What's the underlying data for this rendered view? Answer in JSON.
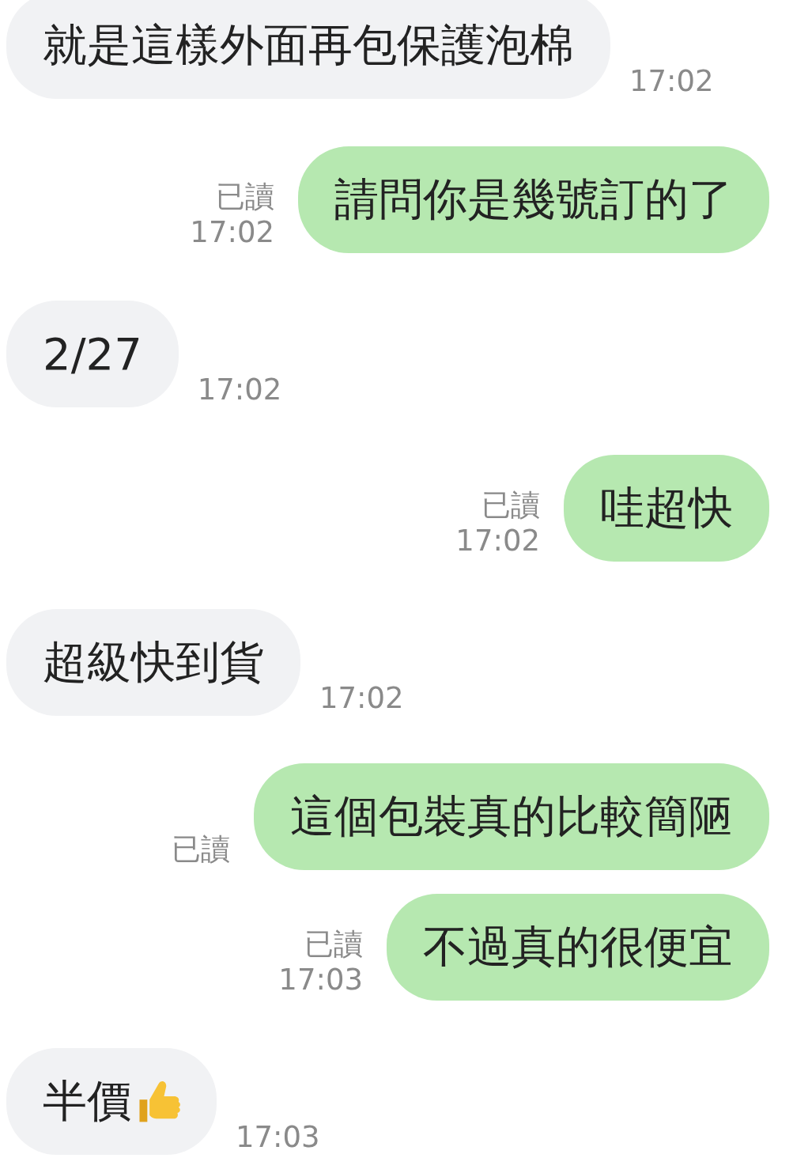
{
  "messages": [
    {
      "kind": "incoming",
      "text": "就是這樣外面再包保護泡棉",
      "time": "17:02"
    },
    {
      "kind": "outgoing",
      "text": "請問你是幾號訂的了",
      "read_label": "已讀",
      "time": "17:02"
    },
    {
      "kind": "incoming",
      "text": "2/27",
      "time": "17:02"
    },
    {
      "kind": "outgoing",
      "text": "哇超快",
      "read_label": "已讀",
      "time": "17:02"
    },
    {
      "kind": "incoming",
      "text": "超級快到貨",
      "time": "17:02"
    },
    {
      "kind": "outgoing",
      "text": "這個包裝真的比較簡陋",
      "read_label": "已讀"
    },
    {
      "kind": "outgoing",
      "text": "不過真的很便宜",
      "read_label": "已讀",
      "time": "17:03"
    },
    {
      "kind": "incoming",
      "text": "半價",
      "emoji": true,
      "time": "17:03"
    }
  ]
}
